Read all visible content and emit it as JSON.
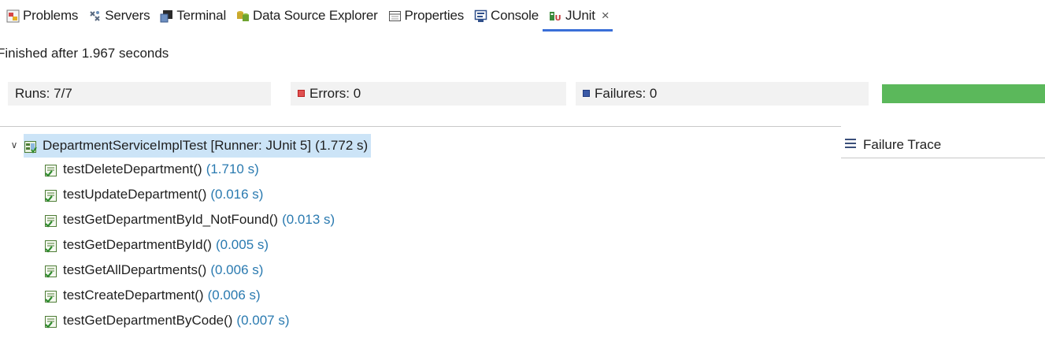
{
  "tabs": [
    {
      "label": "Problems",
      "icon": "problems-icon",
      "active": false
    },
    {
      "label": "Servers",
      "icon": "servers-icon",
      "active": false
    },
    {
      "label": "Terminal",
      "icon": "terminal-icon",
      "active": false
    },
    {
      "label": "Data Source Explorer",
      "icon": "data-source-icon",
      "active": false
    },
    {
      "label": "Properties",
      "icon": "properties-icon",
      "active": false
    },
    {
      "label": "Console",
      "icon": "console-icon",
      "active": false
    },
    {
      "label": "JUnit",
      "icon": "junit-icon",
      "active": true,
      "close": "×"
    }
  ],
  "status": "Finished after 1.967 seconds",
  "counters": {
    "runs_label": "Runs:",
    "runs_value": "7/7",
    "errors_label": "Errors:",
    "errors_value": "0",
    "failures_label": "Failures:",
    "failures_value": "0",
    "progress_fraction": 1.0,
    "progress_color": "#5bb85b"
  },
  "tree": {
    "root": {
      "label": "DepartmentServiceImplTest [Runner: JUnit 5]",
      "duration": "(1.772 s)",
      "expanded": true
    },
    "tests": [
      {
        "name": "testDeleteDepartment()",
        "duration": "(1.710 s)"
      },
      {
        "name": "testUpdateDepartment()",
        "duration": "(0.016 s)"
      },
      {
        "name": "testGetDepartmentById_NotFound()",
        "duration": "(0.013 s)"
      },
      {
        "name": "testGetDepartmentById()",
        "duration": "(0.005 s)"
      },
      {
        "name": "testGetAllDepartments()",
        "duration": "(0.006 s)"
      },
      {
        "name": "testCreateDepartment()",
        "duration": "(0.006 s)"
      },
      {
        "name": "testGetDepartmentByCode()",
        "duration": "(0.007 s)"
      }
    ]
  },
  "failure_trace": {
    "label": "Failure Trace"
  },
  "colors": {
    "accent": "#3a6fd8",
    "selection": "#cce4f7",
    "duration": "#2a7ab0",
    "success": "#5bb85b"
  }
}
